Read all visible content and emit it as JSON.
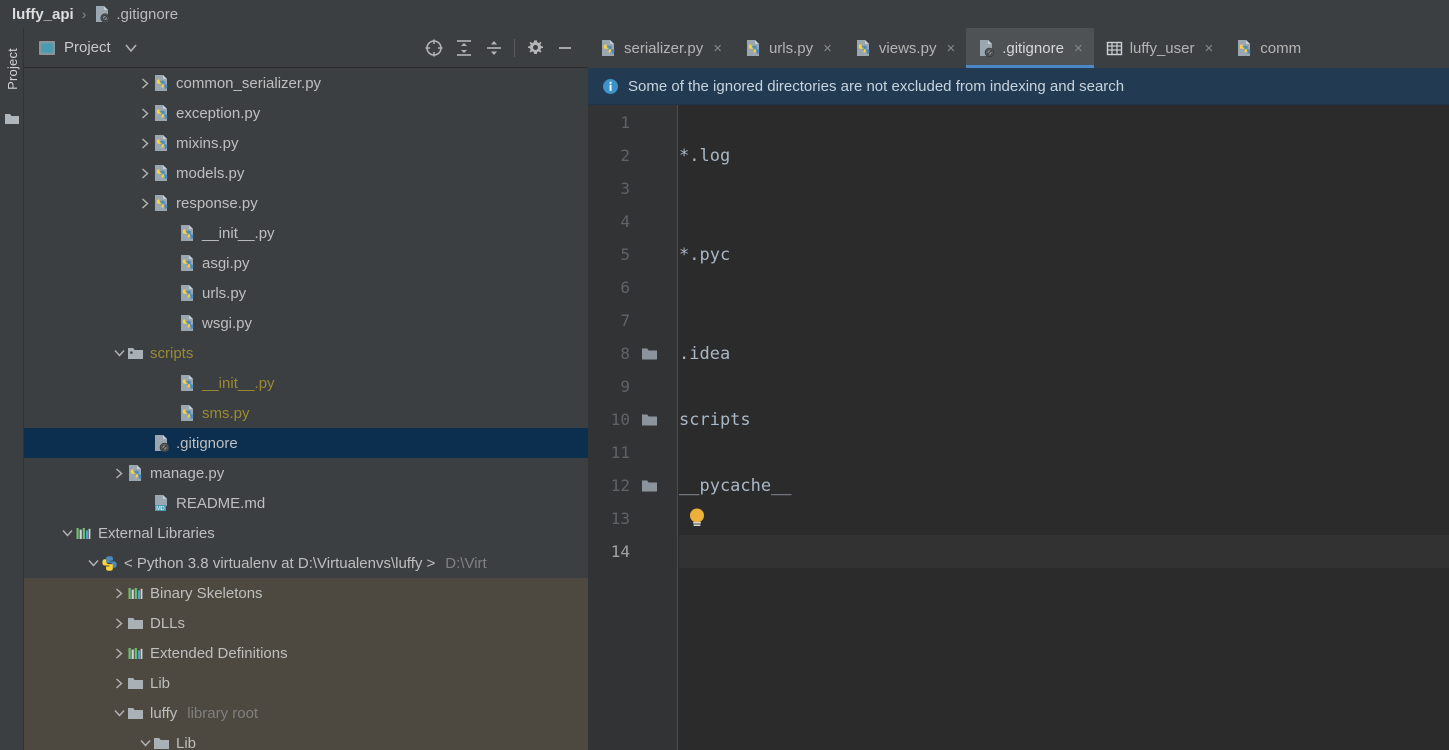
{
  "breadcrumb": {
    "root": "luffy_api",
    "separator": "›",
    "leaf": "​.gitignore",
    "leaf_icon": "gitignore-file-icon"
  },
  "tool_strip": {
    "tab_label": "Project",
    "folder_icon": "folder-icon"
  },
  "project_panel": {
    "toolbar": {
      "icon": "project-view-icon",
      "title": "Project",
      "caret_icon": "chevron-down-icon",
      "buttons": [
        {
          "name": "select-opened-file-icon",
          "label": "Select Opened File"
        },
        {
          "name": "expand-all-icon",
          "label": "Expand All"
        },
        {
          "name": "collapse-all-icon",
          "label": "Collapse All"
        },
        {
          "name": "gear-icon",
          "label": "Options"
        },
        {
          "name": "minimize-icon",
          "label": "Hide"
        }
      ]
    },
    "tree": [
      {
        "indent": 4,
        "arrow": "right",
        "icon": "python-file-icon",
        "label": "common_serializer.py",
        "state": "normal"
      },
      {
        "indent": 4,
        "arrow": "right",
        "icon": "python-file-icon",
        "label": "exception.py",
        "state": "normal"
      },
      {
        "indent": 4,
        "arrow": "right",
        "icon": "python-file-icon",
        "label": "mixins.py",
        "state": "normal"
      },
      {
        "indent": 4,
        "arrow": "right",
        "icon": "python-file-icon",
        "label": "models.py",
        "state": "normal"
      },
      {
        "indent": 4,
        "arrow": "right",
        "icon": "python-file-icon",
        "label": "response.py",
        "state": "normal"
      },
      {
        "indent": 5,
        "arrow": "none",
        "icon": "python-file-icon",
        "label": "__init__.py",
        "state": "normal"
      },
      {
        "indent": 5,
        "arrow": "none",
        "icon": "python-file-icon",
        "label": "asgi.py",
        "state": "normal"
      },
      {
        "indent": 5,
        "arrow": "none",
        "icon": "python-file-icon",
        "label": "urls.py",
        "state": "normal"
      },
      {
        "indent": 5,
        "arrow": "none",
        "icon": "python-file-icon",
        "label": "wsgi.py",
        "state": "normal"
      },
      {
        "indent": 3,
        "arrow": "down",
        "icon": "source-folder-icon",
        "label": "scripts",
        "state": "ignored"
      },
      {
        "indent": 5,
        "arrow": "none",
        "icon": "python-file-icon",
        "label": "__init__.py",
        "state": "ignored"
      },
      {
        "indent": 5,
        "arrow": "none",
        "icon": "python-file-icon",
        "label": "sms.py",
        "state": "ignored"
      },
      {
        "indent": 4,
        "arrow": "none",
        "icon": "gitignore-file-icon",
        "label": ".gitignore",
        "state": "selected"
      },
      {
        "indent": 3,
        "arrow": "right",
        "icon": "python-file-icon",
        "label": "manage.py",
        "state": "normal"
      },
      {
        "indent": 4,
        "arrow": "none",
        "icon": "markdown-file-icon",
        "label": "README.md",
        "state": "normal"
      },
      {
        "indent": 1,
        "arrow": "down",
        "icon": "library-icon",
        "label": "External Libraries",
        "state": "normal"
      },
      {
        "indent": 2,
        "arrow": "down",
        "icon": "python-sdk-icon",
        "label": "< Python 3.8 virtualenv at D:\\Virtualenvs\\luffy >",
        "suffix": "D:\\Virt",
        "state": "normal"
      },
      {
        "indent": 3,
        "arrow": "right",
        "icon": "library-icon",
        "label": "Binary Skeletons",
        "state": "normal",
        "dim": true
      },
      {
        "indent": 3,
        "arrow": "right",
        "icon": "folder-icon",
        "label": "DLLs",
        "state": "normal",
        "dim": true
      },
      {
        "indent": 3,
        "arrow": "right",
        "icon": "library-icon",
        "label": "Extended Definitions",
        "state": "normal",
        "dim": true
      },
      {
        "indent": 3,
        "arrow": "right",
        "icon": "folder-icon",
        "label": "Lib",
        "state": "normal",
        "dim": true
      },
      {
        "indent": 3,
        "arrow": "down",
        "icon": "folder-icon",
        "label": "luffy",
        "suffix": "library root",
        "state": "normal",
        "dim": true
      },
      {
        "indent": 4,
        "arrow": "down",
        "icon": "folder-icon",
        "label": "Lib",
        "state": "normal",
        "dim": true
      }
    ]
  },
  "editor": {
    "tabs": [
      {
        "icon": "python-file-icon",
        "label": "serializer.py",
        "close": "×",
        "active": false
      },
      {
        "icon": "python-file-icon",
        "label": "urls.py",
        "close": "×",
        "active": false
      },
      {
        "icon": "python-file-icon",
        "label": "views.py",
        "close": "×",
        "active": false
      },
      {
        "icon": "gitignore-file-icon",
        "label": ".gitignore",
        "close": "×",
        "active": true
      },
      {
        "icon": "database-table-icon",
        "label": "luffy_user",
        "close": "×",
        "active": false
      },
      {
        "icon": "python-file-icon",
        "label": "comm",
        "close": "",
        "active": false
      }
    ],
    "notification": {
      "icon": "info-icon",
      "text": "Some of the ignored directories are not excluded from indexing and search"
    },
    "bulb_icon": "intention-bulb-icon",
    "current_line": 14,
    "lines": [
      {
        "num": "1",
        "text": "",
        "folder": false
      },
      {
        "num": "2",
        "text": "*.log",
        "folder": false
      },
      {
        "num": "3",
        "text": "",
        "folder": false
      },
      {
        "num": "4",
        "text": "",
        "folder": false
      },
      {
        "num": "5",
        "text": "*.pyc",
        "folder": false
      },
      {
        "num": "6",
        "text": "",
        "folder": false
      },
      {
        "num": "7",
        "text": "",
        "folder": false
      },
      {
        "num": "8",
        "text": ".idea",
        "folder": true
      },
      {
        "num": "9",
        "text": "",
        "folder": false
      },
      {
        "num": "10",
        "text": "scripts",
        "folder": true
      },
      {
        "num": "11",
        "text": "",
        "folder": false
      },
      {
        "num": "12",
        "text": "__pycache__",
        "folder": true
      },
      {
        "num": "13",
        "text": "",
        "folder": false
      },
      {
        "num": "14",
        "text": "",
        "folder": false
      }
    ]
  },
  "colors": {
    "panel_bg": "#3c3f41",
    "editor_bg": "#2b2b2b",
    "gutter_bg": "#313335",
    "tab_active_bg": "#4e5254",
    "tab_underline": "#4a88c7",
    "selection_bg": "#0d2f4f",
    "notification_bg": "#223a52",
    "ignored_text": "#9a8a33",
    "code_text": "#a9b7c6"
  }
}
